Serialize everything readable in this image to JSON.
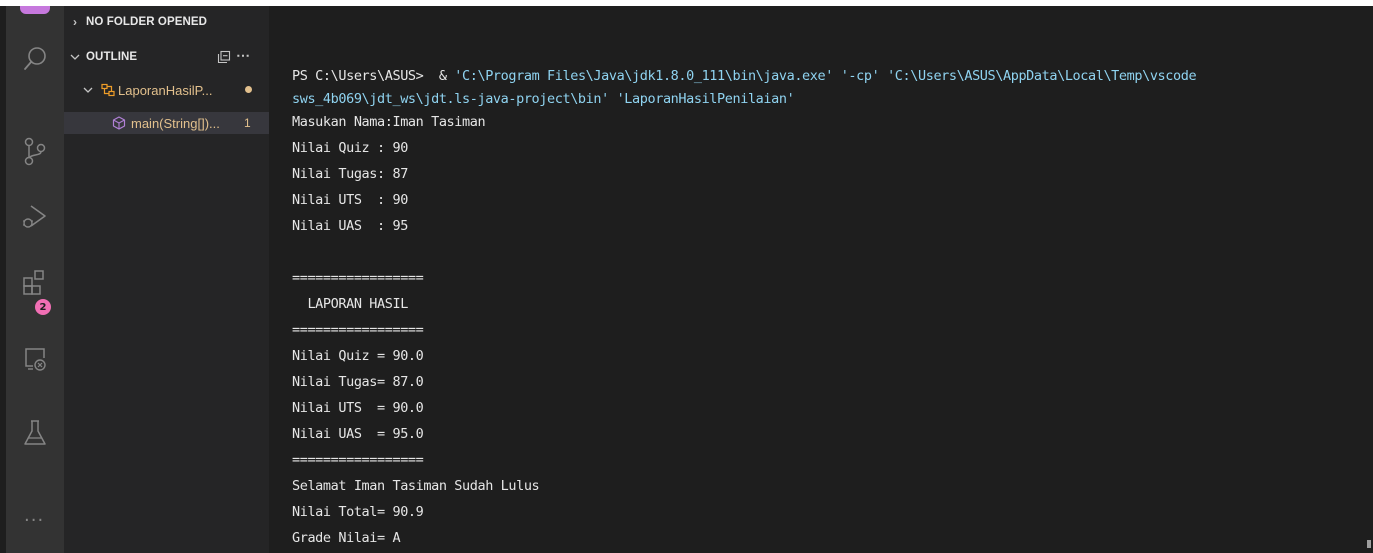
{
  "sidebar": {
    "no_folder_label": "NO FOLDER OPENED",
    "outline_label": "OUTLINE",
    "class_label": "LaporanHasilP...",
    "method_label": "main(String[])...",
    "method_count": "1"
  },
  "activity_bar": {
    "icons": [
      "search-icon",
      "source-control-icon",
      "run-debug-icon",
      "extensions-icon",
      "remote-explorer-icon",
      "testing-icon",
      "more-icon"
    ],
    "extensions_badge": "2",
    "more_label": "···"
  },
  "terminal": {
    "command": {
      "prompt": "PS C:\\Users\\ASUS>  & ",
      "java_exe": "'C:\\Program Files\\Java\\jdk1.8.0_111\\bin\\java.exe'",
      "cp_flag": "'-cp'",
      "classpath_part1": "'C:\\Users\\ASUS\\AppData\\Local\\Temp\\vscode",
      "classpath_part2": "sws_4b069\\jdt_ws\\jdt.ls-java-project\\bin'",
      "main_class": "'LaporanHasilPenilaian'"
    },
    "lines": [
      "Masukan Nama:Iman Tasiman",
      "Nilai Quiz : 90",
      "Nilai Tugas: 87",
      "Nilai UTS  : 90",
      "Nilai UAS  : 95",
      "",
      "=================",
      "  LAPORAN HASIL",
      "=================",
      "Nilai Quiz = 90.0",
      "Nilai Tugas= 87.0",
      "Nilai UTS  = 90.0",
      "Nilai UAS  = 95.0",
      "=================",
      "Selamat Iman Tasiman Sudah Lulus",
      "Nilai Total= 90.9",
      "Grade Nilai= A"
    ]
  },
  "colors": {
    "activity_bar": "#333333",
    "sidebar": "#252526",
    "terminal_bg": "#1e1e1e",
    "string_color": "#8fd3f0",
    "badge": "#f16fb4",
    "modified_dot": "#e2c08d",
    "class_icon": "#ee9d28",
    "method_icon": "#b180d7"
  }
}
